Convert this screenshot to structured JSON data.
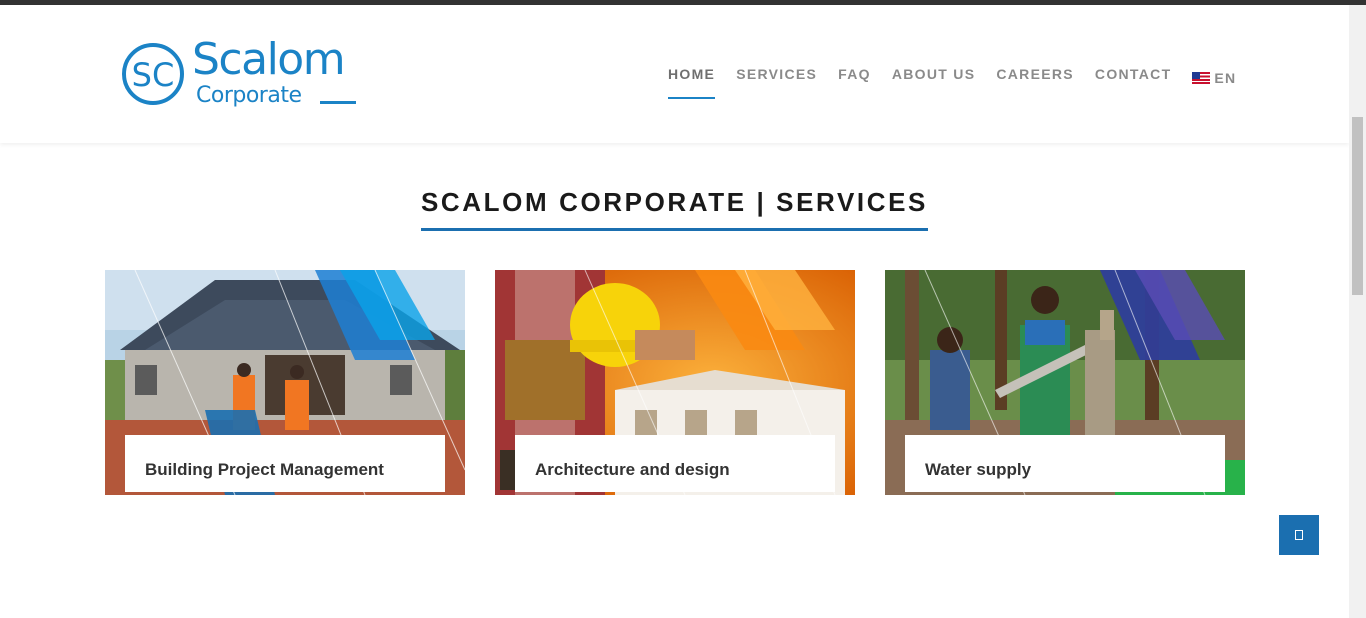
{
  "colors": {
    "brand": "#1b83c6",
    "accent": "#1b6fb0",
    "text_dark": "#1a1a1a",
    "nav": "#8a8a8a"
  },
  "logo": {
    "mark": "SC",
    "name": "Scalom",
    "sub": "Corporate"
  },
  "nav": {
    "items": [
      {
        "label": "HOME",
        "active": true
      },
      {
        "label": "SERVICES"
      },
      {
        "label": "FAQ"
      },
      {
        "label": "ABOUT US"
      },
      {
        "label": "CAREERS"
      },
      {
        "label": "CONTACT"
      }
    ],
    "language": {
      "label": "EN",
      "icon": "us-flag-icon"
    }
  },
  "section": {
    "title": "SCALOM CORPORATE | SERVICES"
  },
  "services": [
    {
      "label": "Building Project Management",
      "image": "construction-site-photo"
    },
    {
      "label": "Architecture and design",
      "image": "builder-helmet-photo"
    },
    {
      "label": "Water supply",
      "image": "water-pump-photo"
    }
  ],
  "back_to_top": {
    "icon": "arrow-up-icon"
  }
}
